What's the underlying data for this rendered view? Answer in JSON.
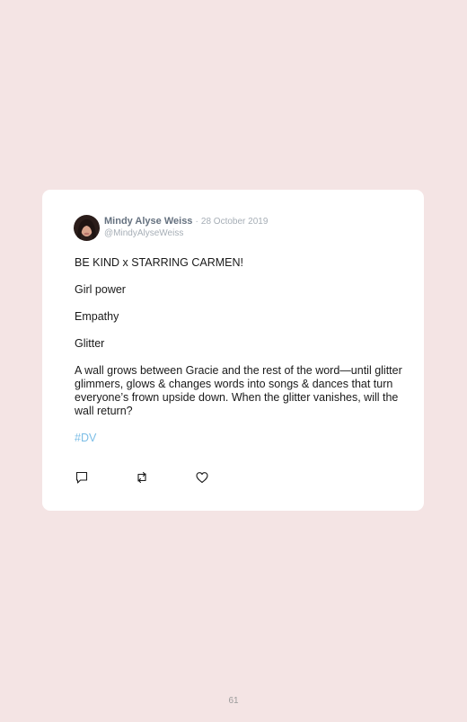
{
  "tweet": {
    "author_name": "Mindy Alyse Weiss",
    "separator": "·",
    "date": "28 October 2019",
    "handle": "@MindyAlyseWeiss",
    "lines": [
      "BE KIND x STARRING CARMEN!",
      "Girl power",
      "Empathy",
      "Glitter",
      "A wall grows between Gracie and the rest of the word—until glitter glimmers, glows & changes words into songs & dances that turn everyone’s frown upside down. When the glitter vanishes, will the wall return?"
    ],
    "hashtag": "#DV",
    "actions": [
      {
        "name": "reply",
        "icon": "reply-icon"
      },
      {
        "name": "retweet",
        "icon": "retweet-icon"
      },
      {
        "name": "like",
        "icon": "heart-icon"
      }
    ]
  },
  "page_number": "61",
  "colors": {
    "background": "#f4e4e4",
    "card": "#ffffff",
    "name": "#667280",
    "muted": "#a6aeb6",
    "hashtag": "#7bbde6"
  }
}
